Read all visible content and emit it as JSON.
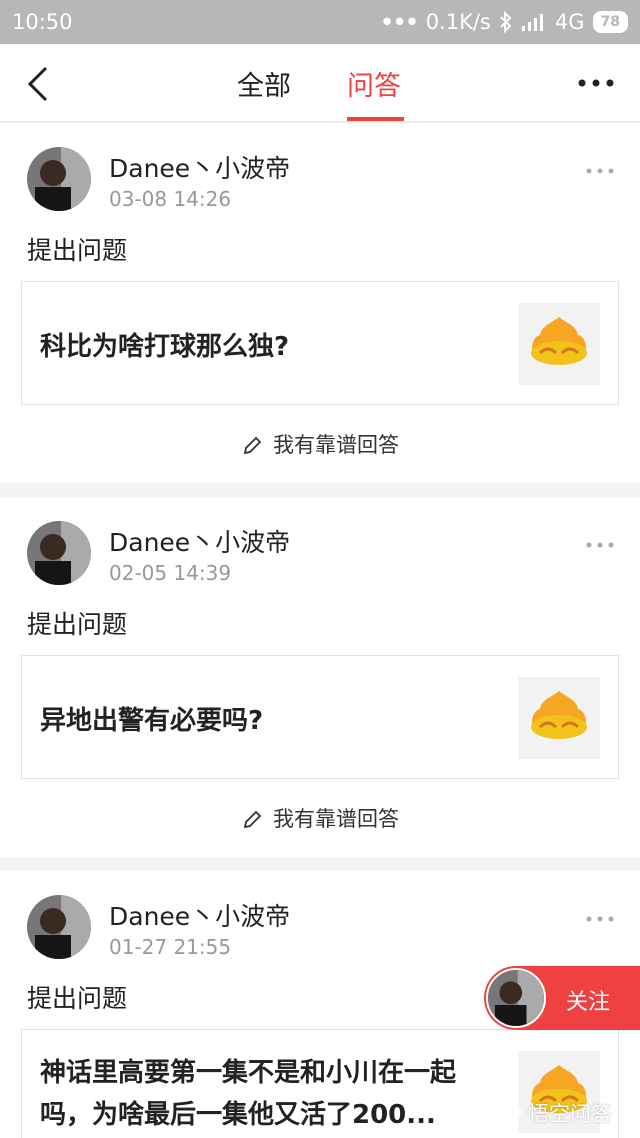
{
  "status_bar": {
    "time": "10:50",
    "dots": "•••",
    "speed": "0.1K/s",
    "network": "4G",
    "battery": "78"
  },
  "nav": {
    "tabs": [
      {
        "label": "全部"
      },
      {
        "label": "问答"
      }
    ],
    "active_tab": "问答"
  },
  "posts": [
    {
      "username": "Danee丶小波帝",
      "date": "03-08 14:26",
      "action": "提出问题",
      "question": "科比为啥打球那么独?",
      "answer_label": "我有靠谱回答"
    },
    {
      "username": "Danee丶小波帝",
      "date": "02-05 14:39",
      "action": "提出问题",
      "question": "异地出警有必要吗?",
      "answer_label": "我有靠谱回答"
    },
    {
      "username": "Danee丶小波帝",
      "date": "01-27 21:55",
      "action": "提出问题",
      "question": "神话里高要第一集不是和小川在一起吗，为啥最后一集他又活了200..."
    }
  ],
  "follow": {
    "label": "关注"
  },
  "watermark": {
    "text": "悟空问答"
  },
  "colors": {
    "accent": "#f04142",
    "status_bar": "#b7b7b7",
    "date_gray": "#999999"
  }
}
